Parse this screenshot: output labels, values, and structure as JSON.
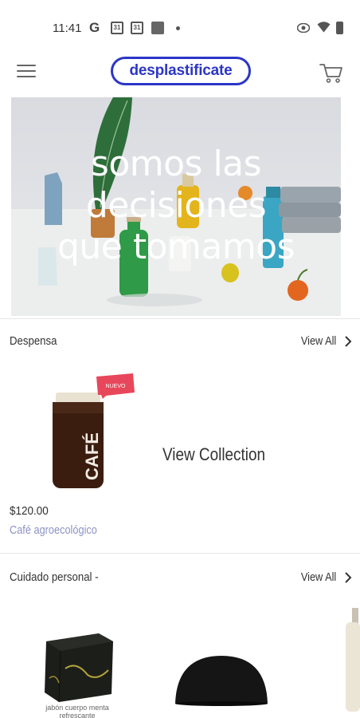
{
  "status_bar": {
    "time": "11:41",
    "icons": [
      "google-g-icon",
      "calendar-icon",
      "calendar-icon",
      "square-app-icon",
      "dot-icon",
      "eye-icon",
      "wifi-icon",
      "battery-icon"
    ],
    "cal1": "31",
    "cal2": "31",
    "g": "G"
  },
  "header": {
    "logo_text": "desplastificate",
    "brand_color": "#2c36c7"
  },
  "hero": {
    "line1": "somos las",
    "line2": "decisiones",
    "line3": "que tomamos"
  },
  "sections": [
    {
      "title": "Despensa",
      "view_all_label": "View All",
      "badge": "NUEVO",
      "view_collection_label": "View Collection",
      "product": {
        "price": "$120.00",
        "name": "Café agroecológico",
        "jar_label": "CAFÉ"
      }
    },
    {
      "title": "Cuidado personal -",
      "view_all_label": "View All",
      "soap_caption": "jabón cuerpo menta refrescante"
    }
  ]
}
